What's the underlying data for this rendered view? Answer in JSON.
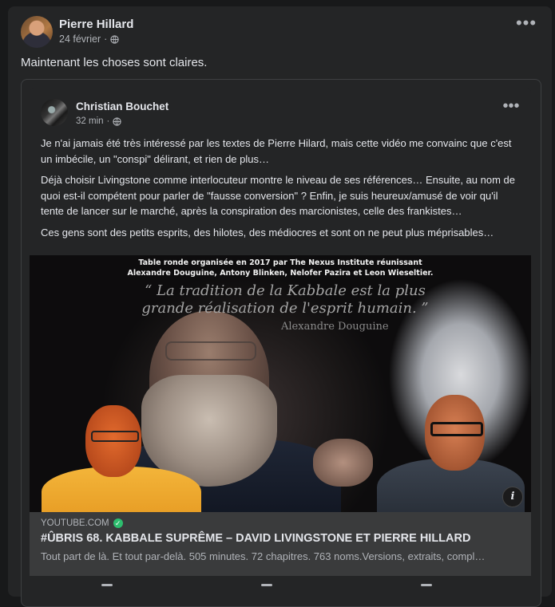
{
  "post": {
    "author": "Pierre Hillard",
    "date": "24 février",
    "separator": "·",
    "text": "Maintenant les choses sont claires.",
    "more_icon": "more-horizontal-icon",
    "audience_icon": "globe-icon"
  },
  "shared_post": {
    "author": "Christian Bouchet",
    "time": "32 min",
    "separator": "·",
    "paragraphs": [
      "Je n'ai jamais été très intéressé par les textes de Pierre Hilard, mais cette vidéo me convainc que c'est un imbécile, un \"conspi\" délirant, et rien de plus…",
      "Déjà choisir Livingstone comme interlocuteur montre le niveau de ses références… Ensuite, au nom de quoi est-il compétent pour parler de \"fausse conversion\" ? Enfin,  je suis heureux/amusé de voir qu'il tente de lancer sur le marché, après la conspiration des marcionistes, celle des frankistes…",
      "Ces gens sont des petits esprits, des hilotes, des médiocres et sont on ne peut plus méprisables…"
    ],
    "video": {
      "header_line1": "Table ronde organisée en 2017 par The Nexus Institute réunissant",
      "header_line2": "Alexandre Douguine, Antony Blinken, Nelofer Pazira et Leon Wieseltier.",
      "quote": "“ La tradition de la Kabbale est la plus grande réalisation de l'esprit humain. ”",
      "quote_author": "Alexandre Douguine",
      "info_label": "i"
    },
    "link": {
      "domain": "YOUTUBE.COM",
      "verified_mark": "✓",
      "title": "#ÛBRIS 68. KABBALE SUPRÊME – DAVID LIVINGSTONE ET PIERRE HILLARD",
      "description": "Tout part de là. Et tout par-delà. 505 minutes. 72 chapitres. 763 noms.Versions, extraits, compl…"
    }
  }
}
